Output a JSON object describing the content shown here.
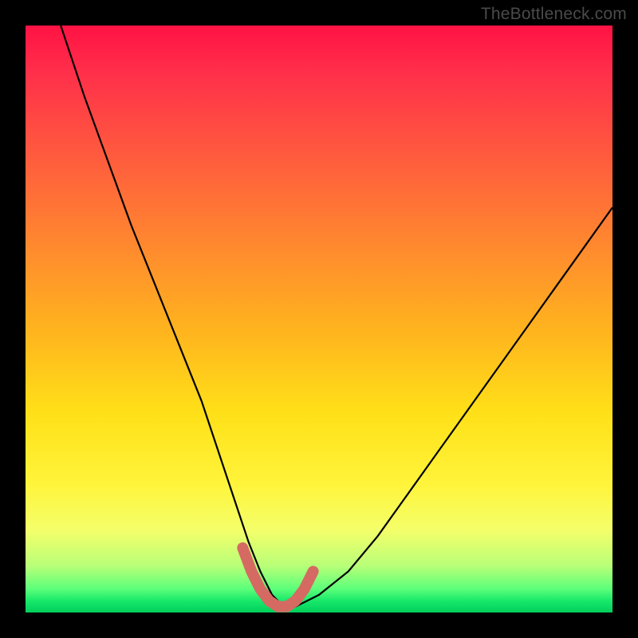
{
  "watermark": {
    "text": "TheBottleneck.com"
  },
  "chart_data": {
    "type": "line",
    "title": "",
    "xlabel": "",
    "ylabel": "",
    "xlim": [
      0,
      100
    ],
    "ylim": [
      0,
      100
    ],
    "series": [
      {
        "name": "bottleneck-curve",
        "x": [
          6,
          10,
          14,
          18,
          22,
          26,
          30,
          34,
          36,
          38,
          40,
          42,
          44,
          46,
          50,
          55,
          60,
          65,
          70,
          75,
          80,
          85,
          90,
          95,
          100
        ],
        "values": [
          100,
          88,
          77,
          66,
          56,
          46,
          36,
          24,
          18,
          12,
          7,
          3,
          1,
          1,
          3,
          7,
          13,
          20,
          27,
          34,
          41,
          48,
          55,
          62,
          69
        ]
      }
    ],
    "highlight_segment": {
      "name": "sweet-spot",
      "color": "#d56a63",
      "x": [
        37,
        38.5,
        40,
        41.5,
        43,
        44.5,
        46,
        47.5,
        49
      ],
      "values": [
        11,
        7,
        4,
        2,
        1,
        1,
        2,
        4,
        7
      ]
    },
    "gradient_meaning": "red = high bottleneck, green = optimal"
  }
}
